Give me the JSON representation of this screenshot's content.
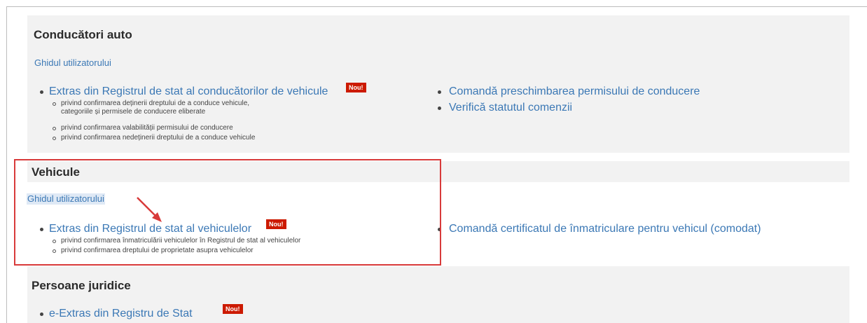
{
  "drivers": {
    "title": "Conducători auto",
    "guide_label": "Ghidul utilizatorului",
    "extract_label": "Extras din Registrul de stat al conducătorilor de vehicule",
    "badge": "Nou!",
    "sub_items": [
      "privind confirmarea deținerii dreptului de a conduce vehicule,",
      "categoriile și permisele de conducere eliberate",
      "privind confirmarea valabilității permisului de conducere",
      "privind confirmarea nedeținerii dreptului de a conduce vehicule"
    ],
    "right_links": [
      "Comandă preschimbarea permisului de conducere",
      "Verifică statutul comenzii"
    ]
  },
  "vehicles": {
    "title": "Vehicule",
    "guide_label": "Ghidul utilizatorului",
    "extract_label": "Extras din Registrul de stat al vehiculelor",
    "badge": "Nou!",
    "sub_items": [
      "privind confirmarea înmatriculării vehiculelor în Registrul de stat al vehiculelor",
      "privind confirmarea dreptului de proprietate asupra vehiculelor"
    ],
    "right_link": "Comandă certificatul de înmatriculare pentru vehicul (comodat)"
  },
  "legal": {
    "title": "Persoane juridice",
    "extract_label": "e-Extras din Registru de Stat",
    "badge": "Nou!"
  },
  "colors": {
    "link": "#3b78b5",
    "badge": "#cc1a00",
    "highlight_box": "#d83a3a",
    "band": "#f2f2f2"
  }
}
